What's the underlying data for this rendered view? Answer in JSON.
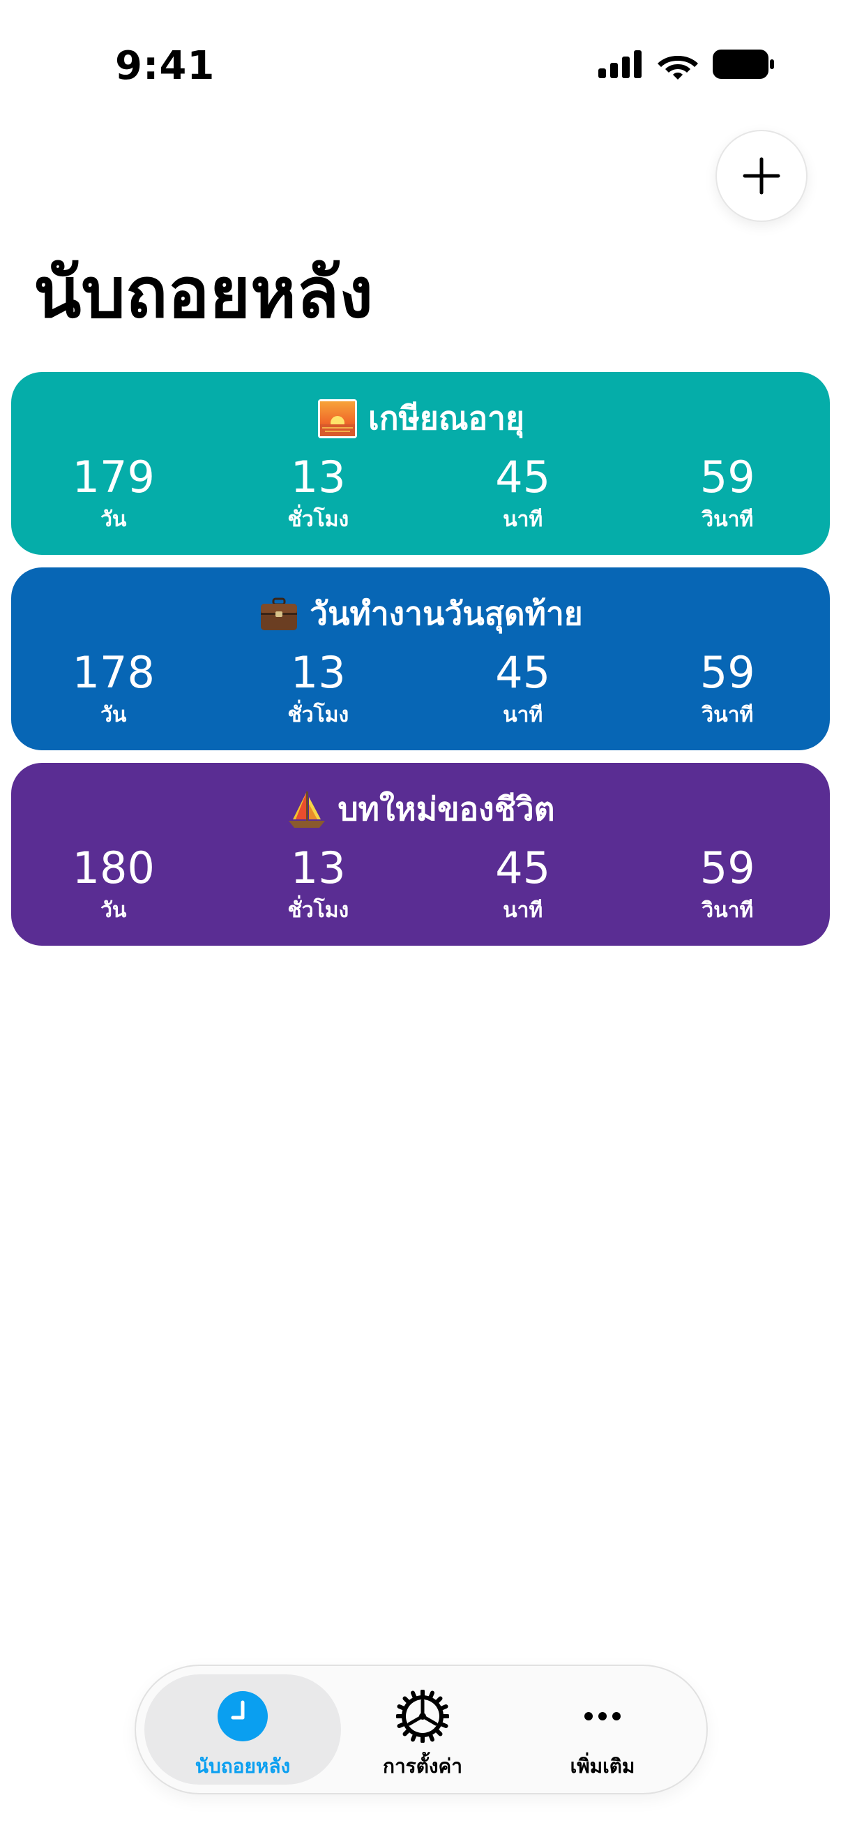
{
  "status_bar": {
    "time": "9:41"
  },
  "header": {
    "title": "นับถอยหลัง",
    "add_icon": "plus-icon"
  },
  "countdowns": [
    {
      "emoji": "sunrise-icon",
      "title": "เกษียณอายุ",
      "color": "#05ADA9",
      "units": [
        {
          "value": "179",
          "label": "วัน"
        },
        {
          "value": "13",
          "label": "ชั่วโมง"
        },
        {
          "value": "45",
          "label": "นาที"
        },
        {
          "value": "59",
          "label": "วินาที"
        }
      ]
    },
    {
      "emoji": "briefcase-icon",
      "title": "วันทำงานวันสุดท้าย",
      "color": "#0766B5",
      "units": [
        {
          "value": "178",
          "label": "วัน"
        },
        {
          "value": "13",
          "label": "ชั่วโมง"
        },
        {
          "value": "45",
          "label": "นาที"
        },
        {
          "value": "59",
          "label": "วินาที"
        }
      ]
    },
    {
      "emoji": "sailboat-icon",
      "title": "บทใหม่ของชีวิต",
      "color": "#5A2D93",
      "units": [
        {
          "value": "180",
          "label": "วัน"
        },
        {
          "value": "13",
          "label": "ชั่วโมง"
        },
        {
          "value": "45",
          "label": "นาที"
        },
        {
          "value": "59",
          "label": "วินาที"
        }
      ]
    }
  ],
  "tab_bar": {
    "tabs": [
      {
        "label": "นับถอยหลัง",
        "icon": "clock-icon",
        "active": true
      },
      {
        "label": "การตั้งค่า",
        "icon": "gear-icon",
        "active": false
      },
      {
        "label": "เพิ่มเติม",
        "icon": "more-icon",
        "active": false
      }
    ],
    "accent_color": "#0A9FF0"
  }
}
